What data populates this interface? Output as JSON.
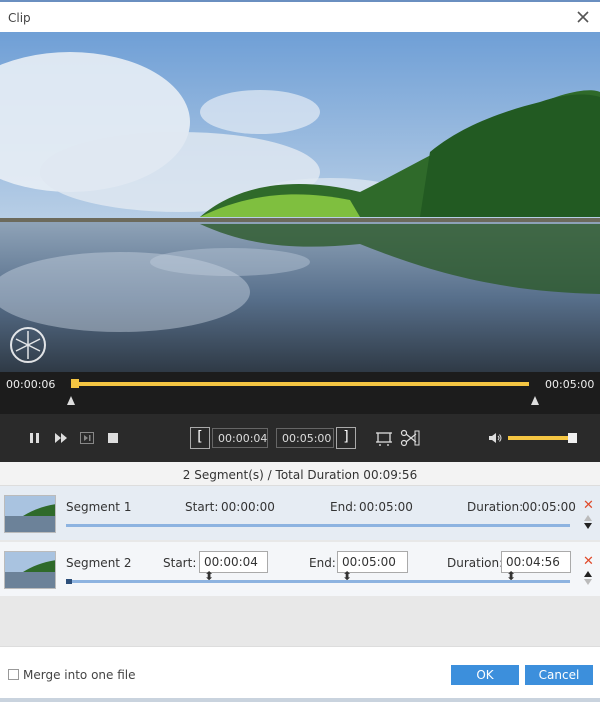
{
  "window": {
    "title": "Clip"
  },
  "timeline": {
    "current_time": "00:00:06",
    "end_time": "00:05:00"
  },
  "controls": {
    "start_time": "00:00:04",
    "end_time": "00:05:00",
    "volume_fraction": 0.93
  },
  "summary": "2 Segment(s) / Total Duration 00:09:56",
  "segments": [
    {
      "name": "Segment 1",
      "start_label": "Start:",
      "start": "00:00:00",
      "end_label": "End:",
      "end": "00:05:00",
      "duration_label": "Duration:",
      "duration": "00:05:00"
    },
    {
      "name": "Segment 2",
      "start_label": "Start:",
      "start": "00:00:04",
      "end_label": "End:",
      "end": "00:05:00",
      "duration_label": "Duration:",
      "duration": "00:04:56"
    }
  ],
  "footer": {
    "merge_label": "Merge into one file",
    "merge_checked": false,
    "ok_label": "OK",
    "cancel_label": "Cancel"
  },
  "colors": {
    "accent": "#f4c542",
    "button": "#3c8fdc",
    "delete": "#e04a2a"
  },
  "icons": [
    "close-icon",
    "pause-icon",
    "fast-forward-icon",
    "frame-step-icon",
    "stop-icon",
    "crop-icon",
    "cut-icon",
    "volume-icon",
    "delete-icon",
    "move-up-icon",
    "move-down-icon",
    "watermark-logo"
  ]
}
